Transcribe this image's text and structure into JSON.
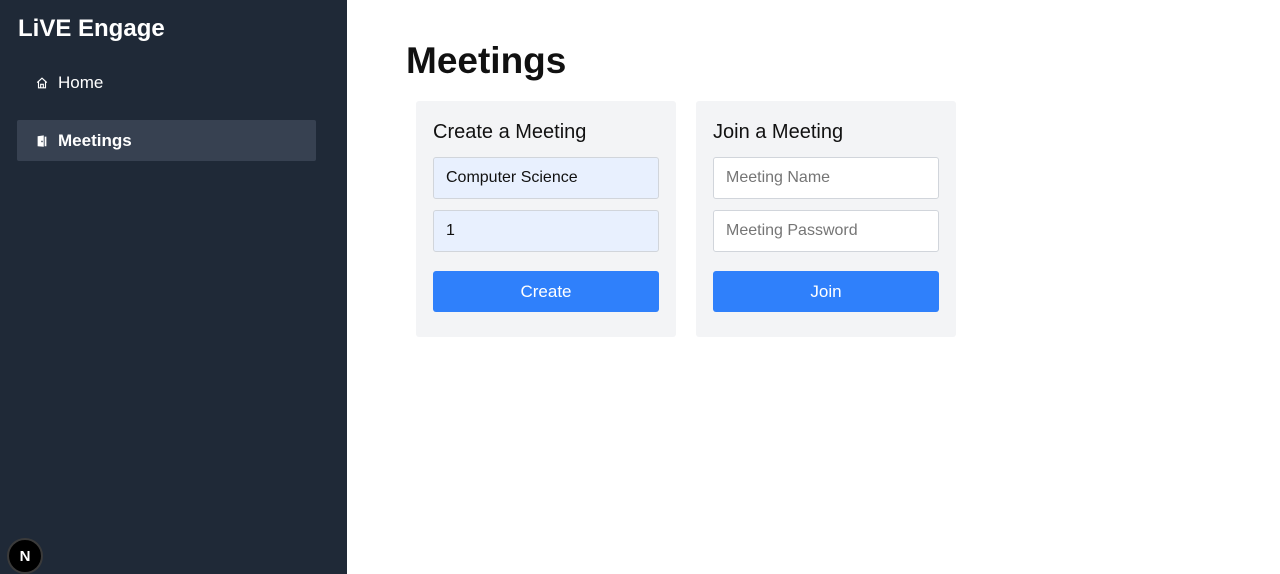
{
  "sidebar": {
    "app_title": "LiVE Engage",
    "items": [
      {
        "label": "Home",
        "icon": "home-icon",
        "active": false
      },
      {
        "label": "Meetings",
        "icon": "door-icon",
        "active": true
      }
    ],
    "dev_badge": "N"
  },
  "main": {
    "title": "Meetings",
    "create_card": {
      "title": "Create a Meeting",
      "name_value": "Computer Science",
      "password_value": "1",
      "button_label": "Create"
    },
    "join_card": {
      "title": "Join a Meeting",
      "name_placeholder": "Meeting Name",
      "password_placeholder": "Meeting Password",
      "button_label": "Join"
    }
  },
  "colors": {
    "sidebar_bg": "#1f2937",
    "active_item_bg": "#374151",
    "card_bg": "#f3f4f6",
    "button_bg": "#2f80fb",
    "autofill_bg": "#e8f0fe"
  }
}
